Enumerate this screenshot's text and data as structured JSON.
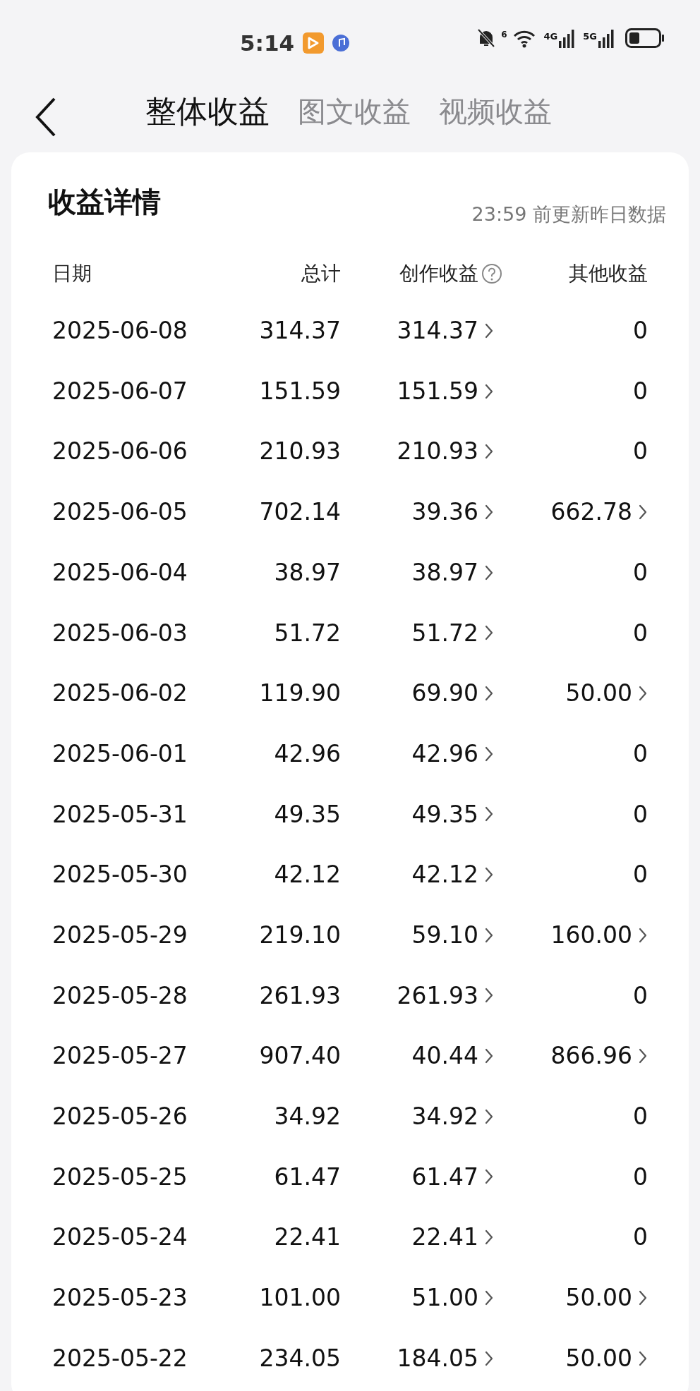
{
  "status_bar": {
    "time": "5:14",
    "wifi_label": "6",
    "signal_labels": [
      "4G",
      "5G"
    ]
  },
  "tabs": [
    {
      "label": "整体收益",
      "selected": true
    },
    {
      "label": "图文收益",
      "selected": false
    },
    {
      "label": "视频收益",
      "selected": false
    }
  ],
  "card": {
    "title": "收益详情",
    "note": "23:59 前更新昨日数据"
  },
  "table": {
    "columns": [
      "日期",
      "总计",
      "创作收益",
      "其他收益"
    ],
    "rows": [
      {
        "date": "2025-06-08",
        "total": "314.37",
        "creation": "314.37",
        "other": "0",
        "other_detail": false
      },
      {
        "date": "2025-06-07",
        "total": "151.59",
        "creation": "151.59",
        "other": "0",
        "other_detail": false
      },
      {
        "date": "2025-06-06",
        "total": "210.93",
        "creation": "210.93",
        "other": "0",
        "other_detail": false
      },
      {
        "date": "2025-06-05",
        "total": "702.14",
        "creation": "39.36",
        "other": "662.78",
        "other_detail": true
      },
      {
        "date": "2025-06-04",
        "total": "38.97",
        "creation": "38.97",
        "other": "0",
        "other_detail": false
      },
      {
        "date": "2025-06-03",
        "total": "51.72",
        "creation": "51.72",
        "other": "0",
        "other_detail": false
      },
      {
        "date": "2025-06-02",
        "total": "119.90",
        "creation": "69.90",
        "other": "50.00",
        "other_detail": true
      },
      {
        "date": "2025-06-01",
        "total": "42.96",
        "creation": "42.96",
        "other": "0",
        "other_detail": false
      },
      {
        "date": "2025-05-31",
        "total": "49.35",
        "creation": "49.35",
        "other": "0",
        "other_detail": false
      },
      {
        "date": "2025-05-30",
        "total": "42.12",
        "creation": "42.12",
        "other": "0",
        "other_detail": false
      },
      {
        "date": "2025-05-29",
        "total": "219.10",
        "creation": "59.10",
        "other": "160.00",
        "other_detail": true
      },
      {
        "date": "2025-05-28",
        "total": "261.93",
        "creation": "261.93",
        "other": "0",
        "other_detail": false
      },
      {
        "date": "2025-05-27",
        "total": "907.40",
        "creation": "40.44",
        "other": "866.96",
        "other_detail": true
      },
      {
        "date": "2025-05-26",
        "total": "34.92",
        "creation": "34.92",
        "other": "0",
        "other_detail": false
      },
      {
        "date": "2025-05-25",
        "total": "61.47",
        "creation": "61.47",
        "other": "0",
        "other_detail": false
      },
      {
        "date": "2025-05-24",
        "total": "22.41",
        "creation": "22.41",
        "other": "0",
        "other_detail": false
      },
      {
        "date": "2025-05-23",
        "total": "101.00",
        "creation": "51.00",
        "other": "50.00",
        "other_detail": true
      },
      {
        "date": "2025-05-22",
        "total": "234.05",
        "creation": "184.05",
        "other": "50.00",
        "other_detail": true
      }
    ]
  }
}
